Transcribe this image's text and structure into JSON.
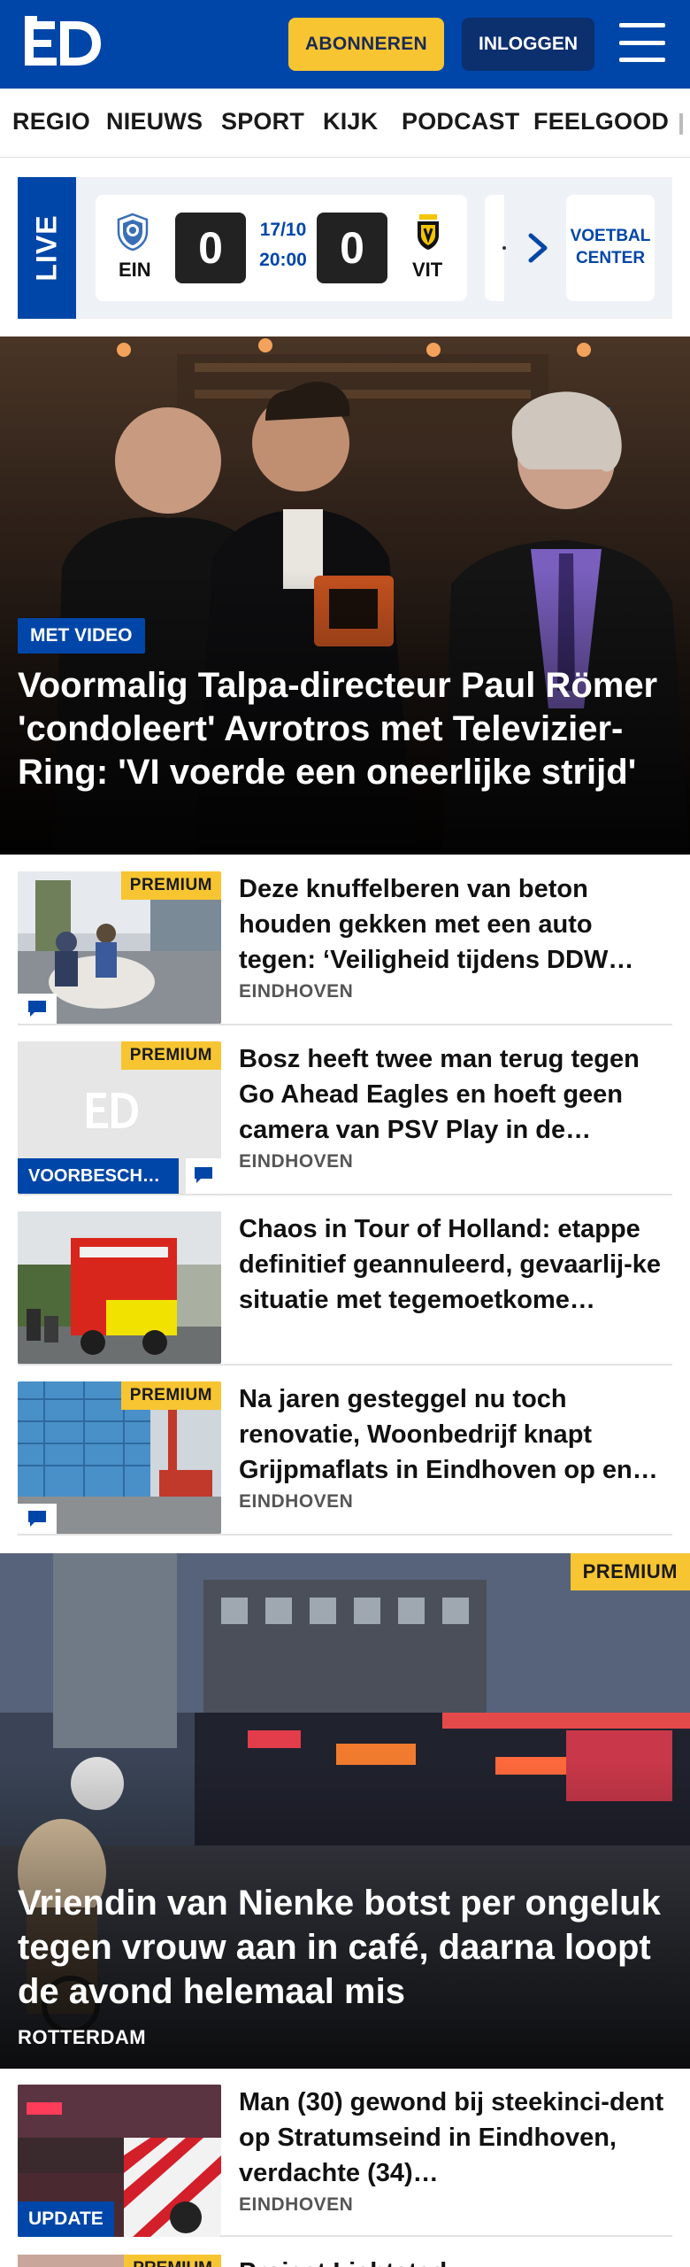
{
  "header": {
    "logo_text": "ED",
    "subscribe_label": "ABONNEREN",
    "login_label": "INLOGGEN",
    "menu_icon": "hamburger-icon",
    "brand_color": "#0046a8",
    "accent_color": "#f7c531"
  },
  "nav": {
    "items": [
      "REGIO",
      "NIEUWS",
      "SPORT",
      "KIJK",
      "PODCAST",
      "FEELGOOD"
    ]
  },
  "live": {
    "label": "LIVE",
    "match": {
      "home": "EIN",
      "away": "VIT",
      "home_score": "0",
      "away_score": "0",
      "date": "17/10",
      "time": "20:00"
    },
    "next_label": "·",
    "voetbal_center": "VOETBAL CENTER"
  },
  "hero": {
    "badge": "MET VIDEO",
    "title": "Voormalig Talpa-directeur Paul Römer 'condoleert' Avrotros met Televizier-Ring: 'VI voerde een oneerlijke strijd'"
  },
  "articles": [
    {
      "title": "Deze knuffelberen van beton houden gekken met een auto tegen: ‘Veiligheid tijdens DDW…",
      "location": "EINDHOVEN",
      "premium": "PREMIUM"
    },
    {
      "title": "Bosz heeft twee man terug tegen Go Ahead Eagles en hoeft geen camera van PSV Play in de…",
      "location": "EINDHOVEN",
      "premium": "PREMIUM",
      "tag": "VOORBESCH…"
    },
    {
      "title": "Chaos in Tour of Holland: etappe definitief geannuleerd, gevaarlij-ke situatie met tegemoetkome…"
    },
    {
      "title": "Na jaren gesteggel nu toch renovatie, Woonbedrijf knapt Grijpmaflats in Eindhoven op en…",
      "location": "EINDHOVEN",
      "premium": "PREMIUM"
    }
  ],
  "feature": {
    "premium": "PREMIUM",
    "title": "Vriendin van Nienke botst per ongeluk tegen vrouw aan in café, daarna loopt de avond helemaal mis",
    "location": "ROTTERDAM"
  },
  "article_after": {
    "title": "Man (30) gewond bij steekinci-dent op Stratumseind in Eindhoven, verdachte (34)…",
    "location": "EINDHOVEN",
    "tag": "UPDATE"
  },
  "partial_next": {
    "premium": "PREMIUM",
    "title": "Project Lichtstad..."
  }
}
